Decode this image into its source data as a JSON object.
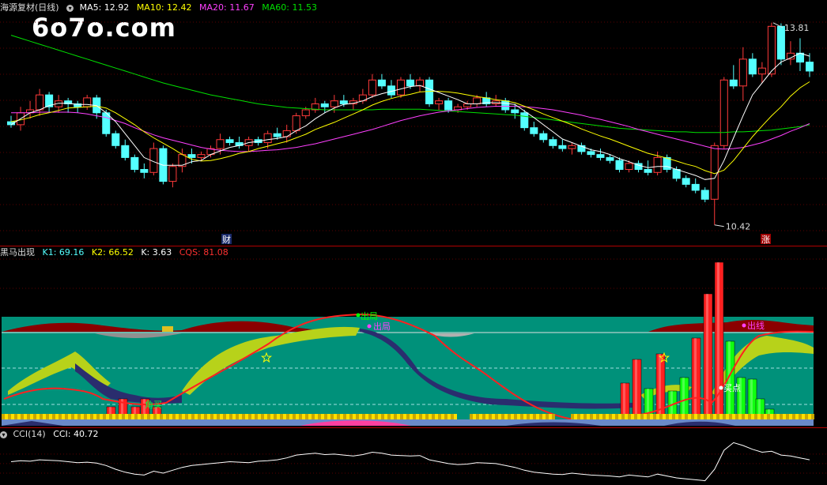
{
  "main_panel": {
    "title": "海源复材(日线)",
    "ma5": "MA5: 12.92",
    "ma10": "MA10: 12.42",
    "ma20": "MA20: 11.67",
    "ma60": "MA60: 11.53",
    "high_label": "13.81",
    "low_label": "10.42",
    "cai_marker": "财",
    "zhang_marker": "涨",
    "watermark": "6o7o.com"
  },
  "indicator_panel": {
    "title": "黑马出现",
    "k1": "K1: 69.16",
    "k2": "K2: 66.52",
    "k": "K: 3.63",
    "cqs": "CQS: 81.08",
    "label_chuju": "出局",
    "label_chuju2": "出局",
    "label_chuxian": "出线",
    "label_maidian": "买点",
    "label_jiaomai": "角买"
  },
  "cci_panel": {
    "title": "CCI(14)",
    "value": "CCI: 40.72"
  },
  "colors": {
    "up": "#ff3a3a",
    "down": "#54ffff",
    "ma5": "#ffffff",
    "ma10": "#ffff00",
    "ma20": "#ff40ff",
    "ma60": "#00e000",
    "teal_bg": "#00917a"
  },
  "candles": [
    [
      12.15,
      12.25,
      12.05,
      12.1
    ],
    [
      12.1,
      12.4,
      12.0,
      12.3
    ],
    [
      12.3,
      12.5,
      12.2,
      12.35
    ],
    [
      12.35,
      12.7,
      12.25,
      12.6
    ],
    [
      12.6,
      12.65,
      12.3,
      12.4
    ],
    [
      12.4,
      12.6,
      12.3,
      12.5
    ],
    [
      12.5,
      12.55,
      12.3,
      12.45
    ],
    [
      12.45,
      12.5,
      12.3,
      12.4
    ],
    [
      12.4,
      12.6,
      12.35,
      12.55
    ],
    [
      12.55,
      12.6,
      12.2,
      12.3
    ],
    [
      12.3,
      12.35,
      11.9,
      11.95
    ],
    [
      11.95,
      12.0,
      11.7,
      11.75
    ],
    [
      11.75,
      11.85,
      11.5,
      11.55
    ],
    [
      11.55,
      11.6,
      11.3,
      11.35
    ],
    [
      11.35,
      11.45,
      11.2,
      11.3
    ],
    [
      11.3,
      11.8,
      11.25,
      11.7
    ],
    [
      11.7,
      11.75,
      11.1,
      11.15
    ],
    [
      11.15,
      11.45,
      11.05,
      11.4
    ],
    [
      11.4,
      11.7,
      11.3,
      11.6
    ],
    [
      11.6,
      11.7,
      11.45,
      11.55
    ],
    [
      11.55,
      11.65,
      11.5,
      11.6
    ],
    [
      11.6,
      11.75,
      11.55,
      11.7
    ],
    [
      11.7,
      11.95,
      11.6,
      11.85
    ],
    [
      11.85,
      11.9,
      11.75,
      11.8
    ],
    [
      11.8,
      11.9,
      11.7,
      11.75
    ],
    [
      11.75,
      11.9,
      11.65,
      11.85
    ],
    [
      11.85,
      11.9,
      11.75,
      11.8
    ],
    [
      11.8,
      12.0,
      11.7,
      11.95
    ],
    [
      11.95,
      12.05,
      11.85,
      11.9
    ],
    [
      11.9,
      12.1,
      11.8,
      12.0
    ],
    [
      12.0,
      12.3,
      11.95,
      12.25
    ],
    [
      12.25,
      12.4,
      12.2,
      12.35
    ],
    [
      12.35,
      12.55,
      12.3,
      12.45
    ],
    [
      12.45,
      12.5,
      12.3,
      12.4
    ],
    [
      12.4,
      12.6,
      12.3,
      12.5
    ],
    [
      12.5,
      12.6,
      12.4,
      12.45
    ],
    [
      12.45,
      12.55,
      12.35,
      12.5
    ],
    [
      12.5,
      12.7,
      12.45,
      12.6
    ],
    [
      12.6,
      12.95,
      12.55,
      12.85
    ],
    [
      12.85,
      12.95,
      12.7,
      12.75
    ],
    [
      12.75,
      12.85,
      12.55,
      12.6
    ],
    [
      12.6,
      12.9,
      12.55,
      12.85
    ],
    [
      12.85,
      12.95,
      12.7,
      12.75
    ],
    [
      12.75,
      12.9,
      12.65,
      12.85
    ],
    [
      12.85,
      12.9,
      12.4,
      12.45
    ],
    [
      12.45,
      12.55,
      12.35,
      12.5
    ],
    [
      12.5,
      12.55,
      12.3,
      12.35
    ],
    [
      12.35,
      12.45,
      12.3,
      12.4
    ],
    [
      12.4,
      12.5,
      12.35,
      12.45
    ],
    [
      12.45,
      12.6,
      12.4,
      12.55
    ],
    [
      12.55,
      12.65,
      12.4,
      12.45
    ],
    [
      12.45,
      12.6,
      12.4,
      12.5
    ],
    [
      12.5,
      12.55,
      12.3,
      12.35
    ],
    [
      12.35,
      12.45,
      12.2,
      12.3
    ],
    [
      12.3,
      12.35,
      12.0,
      12.05
    ],
    [
      12.05,
      12.15,
      11.9,
      11.95
    ],
    [
      11.95,
      12.0,
      11.8,
      11.85
    ],
    [
      11.85,
      11.9,
      11.7,
      11.75
    ],
    [
      11.75,
      11.85,
      11.65,
      11.7
    ],
    [
      11.7,
      11.8,
      11.6,
      11.75
    ],
    [
      11.75,
      11.8,
      11.6,
      11.65
    ],
    [
      11.65,
      11.7,
      11.55,
      11.6
    ],
    [
      11.6,
      11.7,
      11.5,
      11.55
    ],
    [
      11.55,
      11.6,
      11.45,
      11.5
    ],
    [
      11.5,
      11.55,
      11.3,
      11.35
    ],
    [
      11.35,
      11.5,
      11.3,
      11.45
    ],
    [
      11.45,
      11.5,
      11.3,
      11.35
    ],
    [
      11.35,
      11.5,
      11.25,
      11.3
    ],
    [
      11.3,
      11.65,
      11.25,
      11.55
    ],
    [
      11.55,
      11.6,
      11.3,
      11.35
    ],
    [
      11.35,
      11.4,
      11.15,
      11.2
    ],
    [
      11.2,
      11.25,
      11.05,
      11.1
    ],
    [
      11.1,
      11.2,
      10.95,
      11.0
    ],
    [
      11.0,
      11.05,
      10.8,
      10.85
    ],
    [
      10.85,
      11.8,
      10.42,
      11.75
    ],
    [
      11.75,
      12.9,
      11.7,
      12.85
    ],
    [
      12.85,
      13.1,
      12.7,
      12.75
    ],
    [
      12.75,
      13.4,
      12.5,
      13.2
    ],
    [
      13.2,
      13.3,
      12.9,
      12.95
    ],
    [
      12.95,
      13.15,
      12.8,
      13.05
    ],
    [
      12.95,
      13.81,
      12.9,
      13.75
    ],
    [
      13.75,
      13.8,
      13.1,
      13.2
    ],
    [
      13.2,
      13.5,
      13.1,
      13.3
    ],
    [
      13.3,
      13.55,
      13.0,
      13.15
    ],
    [
      13.15,
      13.3,
      12.9,
      13.0
    ]
  ],
  "ma5_vals": [
    12.1,
    12.2,
    12.3,
    12.35,
    12.42,
    12.46,
    12.46,
    12.44,
    12.44,
    12.42,
    12.3,
    12.15,
    11.95,
    11.75,
    11.55,
    11.48,
    11.42,
    11.42,
    11.42,
    11.48,
    11.5,
    11.6,
    11.66,
    11.72,
    11.75,
    11.8,
    11.82,
    11.85,
    11.87,
    11.9,
    12.0,
    12.08,
    12.2,
    12.3,
    12.38,
    12.44,
    12.46,
    12.5,
    12.57,
    12.62,
    12.66,
    12.7,
    12.74,
    12.76,
    12.7,
    12.64,
    12.58,
    12.52,
    12.45,
    12.45,
    12.47,
    12.47,
    12.46,
    12.44,
    12.33,
    12.22,
    12.1,
    11.98,
    11.86,
    11.8,
    11.74,
    11.68,
    11.65,
    11.6,
    11.53,
    11.48,
    11.42,
    11.38,
    11.4,
    11.4,
    11.35,
    11.3,
    11.25,
    11.18,
    11.2,
    11.5,
    11.88,
    12.25,
    12.6,
    12.8,
    13.0,
    13.15,
    13.22,
    13.3,
    13.25
  ],
  "ma10_vals": [
    12.15,
    12.18,
    12.22,
    12.27,
    12.3,
    12.34,
    12.38,
    12.39,
    12.4,
    12.41,
    12.38,
    12.3,
    12.2,
    12.1,
    11.98,
    11.88,
    11.79,
    11.7,
    11.6,
    11.52,
    11.49,
    11.5,
    11.53,
    11.57,
    11.62,
    11.65,
    11.7,
    11.74,
    11.78,
    11.82,
    11.88,
    11.94,
    12.02,
    12.08,
    12.14,
    12.21,
    12.28,
    12.35,
    12.43,
    12.49,
    12.54,
    12.58,
    12.61,
    12.65,
    12.66,
    12.66,
    12.65,
    12.63,
    12.6,
    12.57,
    12.55,
    12.52,
    12.5,
    12.47,
    12.41,
    12.35,
    12.28,
    12.22,
    12.16,
    12.1,
    12.03,
    11.97,
    11.91,
    11.86,
    11.8,
    11.74,
    11.68,
    11.62,
    11.58,
    11.54,
    11.49,
    11.44,
    11.4,
    11.33,
    11.28,
    11.34,
    11.5,
    11.7,
    11.9,
    12.08,
    12.25,
    12.4,
    12.58,
    12.72,
    12.82
  ],
  "ma20_vals": [
    12.3,
    12.3,
    12.3,
    12.31,
    12.31,
    12.31,
    12.31,
    12.3,
    12.28,
    12.25,
    12.22,
    12.17,
    12.12,
    12.05,
    11.99,
    11.93,
    11.88,
    11.84,
    11.8,
    11.76,
    11.72,
    11.69,
    11.67,
    11.66,
    11.65,
    11.65,
    11.66,
    11.67,
    11.68,
    11.7,
    11.72,
    11.75,
    11.78,
    11.82,
    11.86,
    11.9,
    11.94,
    11.98,
    12.02,
    12.07,
    12.12,
    12.17,
    12.21,
    12.25,
    12.28,
    12.31,
    12.33,
    12.35,
    12.37,
    12.39,
    12.4,
    12.41,
    12.41,
    12.41,
    12.4,
    12.39,
    12.37,
    12.35,
    12.32,
    12.29,
    12.26,
    12.22,
    12.19,
    12.15,
    12.11,
    12.07,
    12.02,
    11.98,
    11.94,
    11.9,
    11.86,
    11.82,
    11.78,
    11.74,
    11.7,
    11.69,
    11.7,
    11.72,
    11.76,
    11.8,
    11.86,
    11.92,
    11.99,
    12.05,
    12.12
  ],
  "ma60_vals": [
    13.6,
    13.55,
    13.5,
    13.45,
    13.4,
    13.35,
    13.3,
    13.25,
    13.2,
    13.15,
    13.1,
    13.05,
    13.0,
    12.95,
    12.9,
    12.85,
    12.8,
    12.76,
    12.72,
    12.68,
    12.64,
    12.6,
    12.57,
    12.54,
    12.51,
    12.48,
    12.45,
    12.43,
    12.41,
    12.39,
    12.38,
    12.37,
    12.36,
    12.35,
    12.35,
    12.35,
    12.35,
    12.35,
    12.35,
    12.36,
    12.36,
    12.36,
    12.36,
    12.36,
    12.35,
    12.34,
    12.33,
    12.32,
    12.31,
    12.3,
    12.29,
    12.28,
    12.27,
    12.26,
    12.24,
    12.22,
    12.2,
    12.18,
    12.16,
    12.14,
    12.12,
    12.1,
    12.08,
    12.06,
    12.04,
    12.03,
    12.02,
    12.01,
    12.0,
    11.99,
    11.98,
    11.98,
    11.97,
    11.97,
    11.97,
    11.97,
    11.98,
    11.98,
    11.99,
    12.0,
    12.01,
    12.03,
    12.05,
    12.07,
    12.1
  ],
  "cci_vals": [
    20,
    30,
    25,
    40,
    35,
    30,
    20,
    10,
    15,
    5,
    -20,
    -60,
    -90,
    -110,
    -120,
    -80,
    -100,
    -70,
    -40,
    -20,
    -10,
    0,
    10,
    20,
    15,
    10,
    25,
    30,
    40,
    60,
    90,
    100,
    110,
    95,
    100,
    90,
    80,
    95,
    120,
    110,
    90,
    85,
    80,
    85,
    40,
    20,
    0,
    -10,
    -5,
    10,
    5,
    0,
    -20,
    -40,
    -70,
    -90,
    -100,
    -110,
    -115,
    -100,
    -110,
    -120,
    -125,
    -130,
    -140,
    -120,
    -130,
    -140,
    -110,
    -130,
    -150,
    -160,
    -170,
    -180,
    -60,
    140,
    220,
    190,
    150,
    120,
    130,
    90,
    80,
    60,
    40
  ]
}
